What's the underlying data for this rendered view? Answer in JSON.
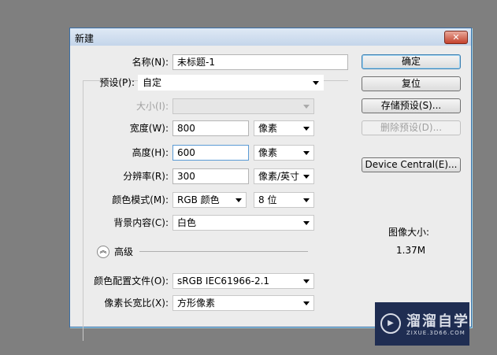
{
  "dialog": {
    "title": "新建",
    "close": "✕"
  },
  "form": {
    "name": {
      "label": "名称(N):",
      "value": "未标题-1"
    },
    "preset": {
      "label": "预设(P):",
      "value": "自定"
    },
    "size": {
      "label": "大小(I):",
      "value": ""
    },
    "width": {
      "label": "宽度(W):",
      "value": "800",
      "unit": "像素"
    },
    "height": {
      "label": "高度(H):",
      "value": "600",
      "unit": "像素"
    },
    "resolution": {
      "label": "分辨率(R):",
      "value": "300",
      "unit": "像素/英寸"
    },
    "color_mode": {
      "label": "颜色模式(M):",
      "value": "RGB 颜色",
      "depth": "8 位"
    },
    "background": {
      "label": "背景内容(C):",
      "value": "白色"
    },
    "advanced": {
      "label": "高级"
    },
    "profile": {
      "label": "颜色配置文件(O):",
      "value": "sRGB IEC61966-2.1"
    },
    "aspect": {
      "label": "像素长宽比(X):",
      "value": "方形像素"
    }
  },
  "buttons": {
    "ok": "确定",
    "reset": "复位",
    "save_preset": "存储预设(S)...",
    "delete_preset": "删除预设(D)...",
    "device_central": "Device Central(E)..."
  },
  "image_size": {
    "label": "图像大小:",
    "value": "1.37M"
  },
  "watermark": {
    "name": "溜溜自学",
    "url": "ZIXUE.3D66.COM"
  }
}
